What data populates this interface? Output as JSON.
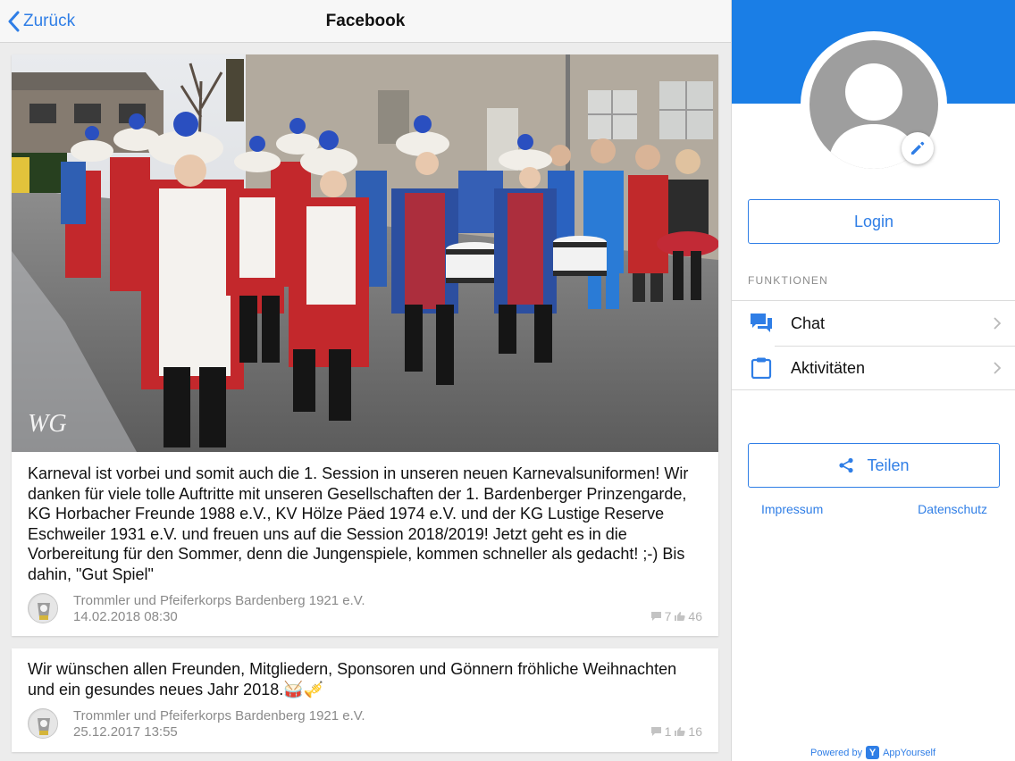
{
  "nav": {
    "back_label": "Zurück",
    "title": "Facebook"
  },
  "posts": [
    {
      "image": "photo-carnival-drum-corps-parade",
      "watermark": "WG",
      "text": "Karneval ist vorbei und somit auch die 1. Session in unseren neuen Karnevalsuniformen! Wir danken für viele tolle Auftritte mit unseren Gesellschaften der 1. Bardenberger Prinzengarde, KG Horbacher Freunde 1988 e.V., KV Hölze Päed 1974 e.V. und der KG Lustige Reserve Eschweiler 1931 e.V. und freuen uns auf die Session 2018/2019! Jetzt geht es in die Vorbereitung für den Sommer, denn die Jungenspiele, kommen schneller als gedacht! ;-) Bis dahin, \"Gut Spiel\"",
      "author": "Trommler und Pfeiferkorps Bardenberg 1921 e.V.",
      "date": "14.02.2018 08:30",
      "comments": "7",
      "likes": "46"
    },
    {
      "text": "Wir wünschen allen Freunden, Mitgliedern, Sponsoren und Gönnern fröhliche Weihnachten und ein gesundes neues Jahr 2018.🥁🎺",
      "author": "Trommler und Pfeiferkorps Bardenberg 1921 e.V.",
      "date": "25.12.2017 13:55",
      "comments": "1",
      "likes": "16"
    }
  ],
  "sidebar": {
    "login_label": "Login",
    "section_title": "FUNKTIONEN",
    "items": [
      {
        "label": "Chat",
        "icon": "chat-icon"
      },
      {
        "label": "Aktivitäten",
        "icon": "clipboard-icon"
      }
    ],
    "share_label": "Teilen",
    "footer_links": [
      "Impressum",
      "Datenschutz"
    ],
    "powered_by": "Powered by",
    "brand": "AppYourself"
  },
  "colors": {
    "accent": "#2f7ee6",
    "banner": "#1a7ee6",
    "avatar_placeholder": "#9e9e9e"
  }
}
